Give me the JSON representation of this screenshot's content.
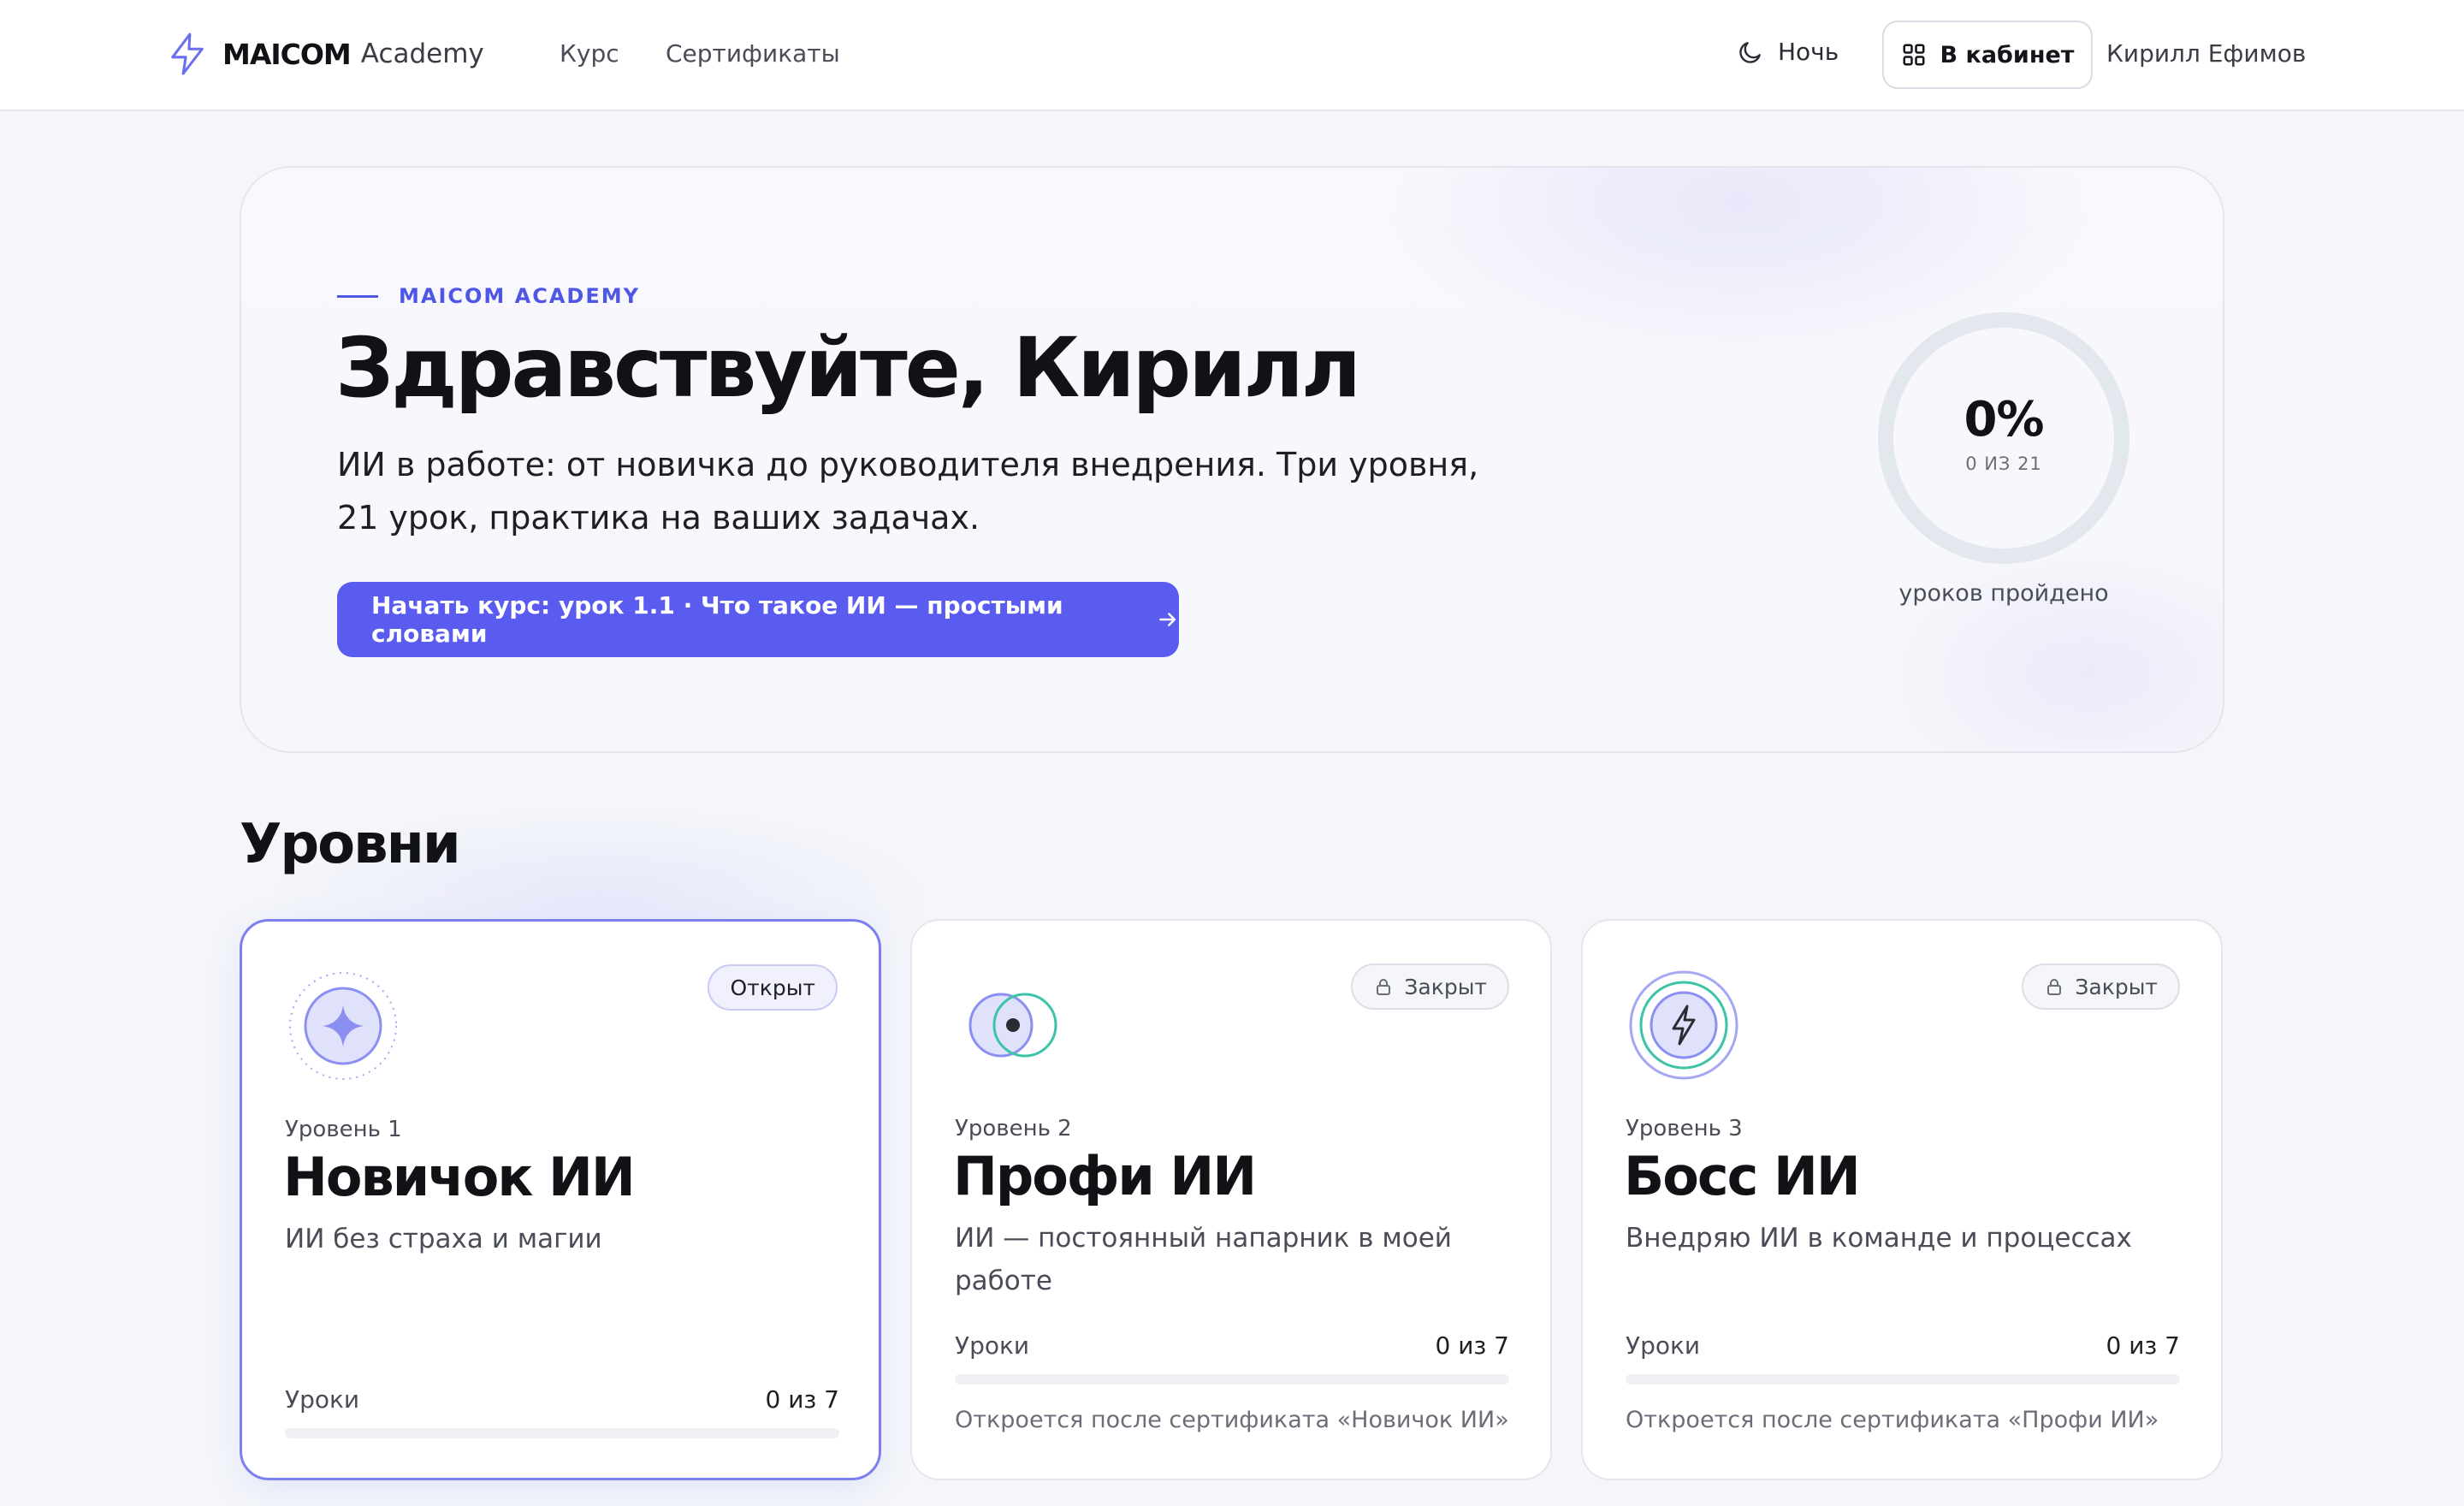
{
  "header": {
    "brand": "MAICOM",
    "brand_sub": "Academy",
    "nav": [
      {
        "label": "Курс"
      },
      {
        "label": "Сертификаты"
      }
    ],
    "theme_toggle": "Ночь",
    "cabinet_button": "В кабинет",
    "user_name": "Кирилл Ефимов"
  },
  "hero": {
    "eyebrow": "MAICOM ACADEMY",
    "title": "Здравствуйте, Кирилл",
    "description": "ИИ в работе: от новичка до руководителя внедрения. Три уровня, 21 урок, практика на ваших задачах.",
    "cta": "Начать курс: урок 1.1 · Что такое ИИ — простыми словами",
    "progress": {
      "percent_label": "0%",
      "count_label": "0 ИЗ 21",
      "caption": "уроков пройдено",
      "completed": 0,
      "total": 21
    }
  },
  "levels": {
    "title": "Уровни",
    "cards": [
      {
        "badge": "Открыт",
        "locked": false,
        "level": "Уровень 1",
        "name": "Новичок ИИ",
        "description": "ИИ без страха и магии",
        "lessons_label": "Уроки",
        "lessons_value": "0 из 7",
        "lessons_progress": 0,
        "unlock_note": ""
      },
      {
        "badge": "Закрыт",
        "locked": true,
        "level": "Уровень 2",
        "name": "Профи ИИ",
        "description": "ИИ — постоянный напарник в моей работе",
        "lessons_label": "Уроки",
        "lessons_value": "0 из 7",
        "lessons_progress": 0,
        "unlock_note": "Откроется после сертификата «Новичок ИИ»"
      },
      {
        "badge": "Закрыт",
        "locked": true,
        "level": "Уровень 3",
        "name": "Босс ИИ",
        "description": "Внедряю ИИ в команде и процессах",
        "lessons_label": "Уроки",
        "lessons_value": "0 из 7",
        "lessons_progress": 0,
        "unlock_note": "Откроется после сертификата «Профи ИИ»"
      }
    ]
  },
  "colors": {
    "accent": "#5a5cf0",
    "accent_text": "#4f56e6",
    "active_border": "#7b7ff0",
    "teal": "#3cc3a8",
    "background": "#f4f6fa"
  },
  "icons": {
    "logo": "lightning-icon",
    "theme": "moon-icon",
    "cabinet": "grid-icon",
    "cta": "arrow-right-icon",
    "locked": "lock-icon",
    "level1": "sparkle-icon",
    "level2": "overlap-circles-icon",
    "level3": "lightning-icon"
  }
}
